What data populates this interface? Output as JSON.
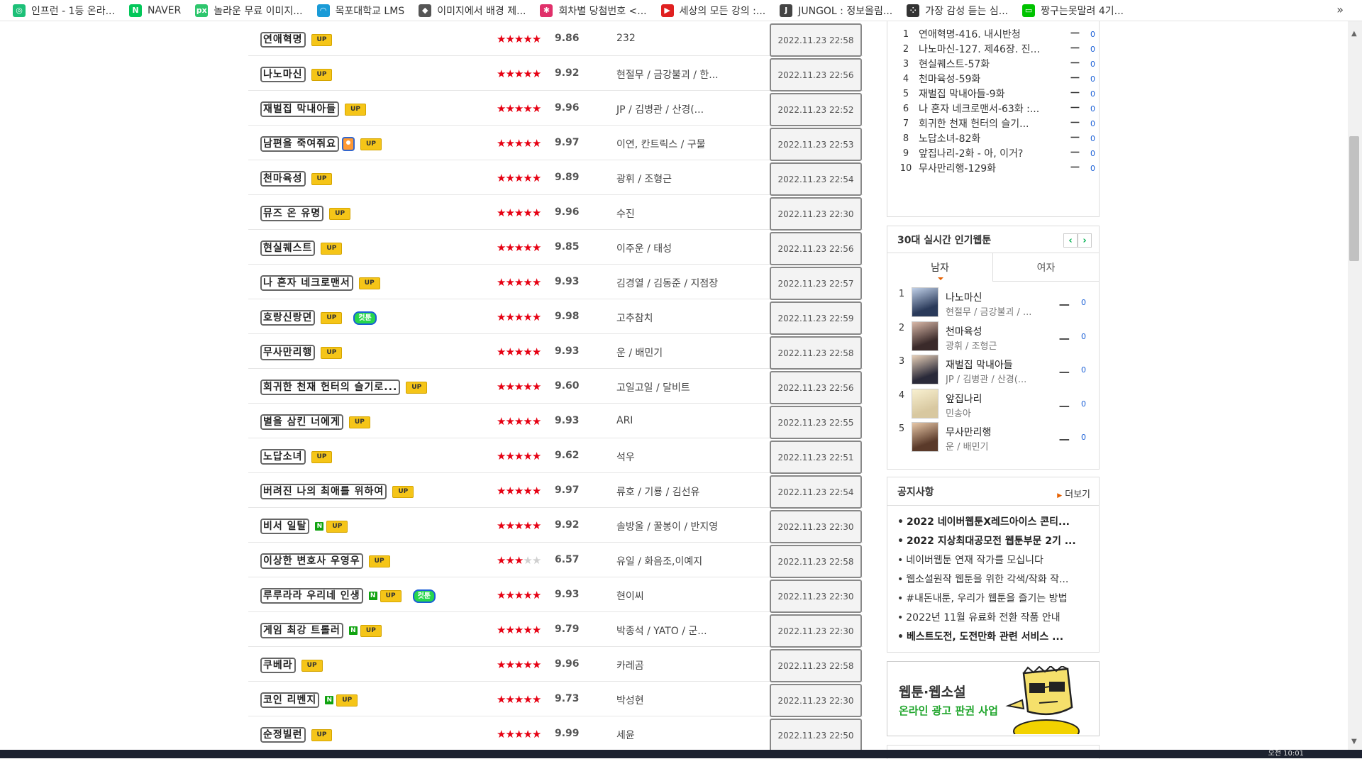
{
  "bookmarks": [
    {
      "label": "인프런 - 1등 온라...",
      "icon": "inflearn-icon",
      "color": "#1dc078",
      "glyph": "◎"
    },
    {
      "label": "NAVER",
      "icon": "naver-icon",
      "color": "#03c75a",
      "glyph": "N"
    },
    {
      "label": "놀라운 무료 이미지...",
      "icon": "pixabay-icon",
      "color": "#2ec66d",
      "glyph": "px"
    },
    {
      "label": "목포대학교 LMS",
      "icon": "lms-icon",
      "color": "#1a9bd7",
      "glyph": "◠"
    },
    {
      "label": "이미지에서 배경 제...",
      "icon": "removebg-icon",
      "color": "#555555",
      "glyph": "◆"
    },
    {
      "label": "회차별 당첨번호 <...",
      "icon": "lotto-icon",
      "color": "#e0306a",
      "glyph": "✱"
    },
    {
      "label": "세상의 모든 강의 :...",
      "icon": "play-icon",
      "color": "#e02020",
      "glyph": "▶"
    },
    {
      "label": "JUNGOL : 정보올림...",
      "icon": "jungol-icon",
      "color": "#444444",
      "glyph": "J"
    },
    {
      "label": "가장 감성 듣는 심...",
      "icon": "music-icon",
      "color": "#333333",
      "glyph": "⁘"
    },
    {
      "label": "짱구는못말려 4기...",
      "icon": "line-icon",
      "color": "#00c300",
      "glyph": "▭"
    }
  ],
  "bookmarks_more": "»",
  "webtoons": [
    {
      "title": "연애혁명",
      "n": false,
      "up": true,
      "extra": "",
      "stars": 5,
      "score": "9.86",
      "author": "232",
      "date": "2022.11.23 22:58"
    },
    {
      "title": "나노마신",
      "n": false,
      "up": true,
      "extra": "",
      "stars": 5,
      "score": "9.92",
      "author": "현절무 / 금강불괴 / 한...",
      "date": "2022.11.23 22:56"
    },
    {
      "title": "재벌집 막내아들",
      "n": false,
      "up": true,
      "extra": "",
      "stars": 5,
      "score": "9.96",
      "author": "JP / 김병관 / 산경(...",
      "date": "2022.11.23 22:52"
    },
    {
      "title": "남편을 죽여줘요",
      "n": false,
      "up": true,
      "extra": "person",
      "stars": 5,
      "score": "9.97",
      "author": "이연, 칸트릭스 / 구물",
      "date": "2022.11.23 22:53"
    },
    {
      "title": "천마육성",
      "n": false,
      "up": true,
      "extra": "",
      "stars": 5,
      "score": "9.89",
      "author": "광휘 / 조형근",
      "date": "2022.11.23 22:54"
    },
    {
      "title": "뮤즈 온 유명",
      "n": false,
      "up": true,
      "extra": "",
      "stars": 5,
      "score": "9.96",
      "author": "수진",
      "date": "2022.11.23 22:30"
    },
    {
      "title": "현실퀘스트",
      "n": false,
      "up": true,
      "extra": "",
      "stars": 5,
      "score": "9.85",
      "author": "이주운 / 태성",
      "date": "2022.11.23 22:56"
    },
    {
      "title": "나 혼자 네크로맨서",
      "n": false,
      "up": true,
      "extra": "",
      "stars": 5,
      "score": "9.93",
      "author": "김경열 / 김동준 / 지점장",
      "date": "2022.11.23 22:57"
    },
    {
      "title": "호랑신랑뎐",
      "n": false,
      "up": true,
      "extra": "cuttoon",
      "stars": 5,
      "score": "9.98",
      "author": "고추참치",
      "date": "2022.11.23 22:59"
    },
    {
      "title": "무사만리행",
      "n": false,
      "up": true,
      "extra": "",
      "stars": 5,
      "score": "9.93",
      "author": "운 / 배민기",
      "date": "2022.11.23 22:58"
    },
    {
      "title": "회귀한 천재 헌터의 슬기로...",
      "n": false,
      "up": true,
      "extra": "",
      "stars": 5,
      "score": "9.60",
      "author": "고일고일 / 달비트",
      "date": "2022.11.23 22:56"
    },
    {
      "title": "별을 삼킨 너에게",
      "n": false,
      "up": true,
      "extra": "",
      "stars": 5,
      "score": "9.93",
      "author": "ARI",
      "date": "2022.11.23 22:55"
    },
    {
      "title": "노답소녀",
      "n": false,
      "up": true,
      "extra": "",
      "stars": 5,
      "score": "9.62",
      "author": "석우",
      "date": "2022.11.23 22:51"
    },
    {
      "title": "버려진 나의 최애를 위하여",
      "n": false,
      "up": true,
      "extra": "",
      "stars": 5,
      "score": "9.97",
      "author": "류호 / 기룡 / 김선유",
      "date": "2022.11.23 22:54"
    },
    {
      "title": "비서 일탈",
      "n": true,
      "up": true,
      "extra": "",
      "stars": 5,
      "score": "9.92",
      "author": "솔방울 / 꿀봉이 / 반지영",
      "date": "2022.11.23 22:30"
    },
    {
      "title": "이상한 변호사 우영우",
      "n": false,
      "up": true,
      "extra": "",
      "stars": 3,
      "score": "6.57",
      "author": "유일 / 화음조,이예지",
      "date": "2022.11.23 22:58"
    },
    {
      "title": "루루라라 우리네 인생",
      "n": true,
      "up": true,
      "extra": "cuttoon",
      "stars": 5,
      "score": "9.93",
      "author": "현이씨",
      "date": "2022.11.23 22:30"
    },
    {
      "title": "게임 최강 트롤러",
      "n": true,
      "up": true,
      "extra": "",
      "stars": 5,
      "score": "9.79",
      "author": "박종석 / YATO / 군...",
      "date": "2022.11.23 22:30"
    },
    {
      "title": "쿠베라",
      "n": false,
      "up": true,
      "extra": "",
      "stars": 5,
      "score": "9.96",
      "author": "카레곰",
      "date": "2022.11.23 22:58"
    },
    {
      "title": "코인 리벤지",
      "n": true,
      "up": true,
      "extra": "",
      "stars": 5,
      "score": "9.73",
      "author": "박성현",
      "date": "2022.11.23 22:30"
    },
    {
      "title": "순정빌런",
      "n": false,
      "up": true,
      "extra": "",
      "stars": 5,
      "score": "9.99",
      "author": "세윤",
      "date": "2022.11.23 22:50"
    }
  ],
  "badges": {
    "up": "UP",
    "n": "N",
    "cuttoon": "컷툰"
  },
  "star_glyph": "★",
  "rank_list": [
    {
      "num": "1",
      "name": "연애혁명-416. 내시반청",
      "change": "ㅡ",
      "count": "0"
    },
    {
      "num": "2",
      "name": "나노마신-127. 제46장. 진...",
      "change": "ㅡ",
      "count": "0"
    },
    {
      "num": "3",
      "name": "현실퀘스트-57화",
      "change": "ㅡ",
      "count": "0"
    },
    {
      "num": "4",
      "name": "천마육성-59화",
      "change": "ㅡ",
      "count": "0"
    },
    {
      "num": "5",
      "name": "재벌집 막내아들-9화",
      "change": "ㅡ",
      "count": "0"
    },
    {
      "num": "6",
      "name": "나 혼자 네크로맨서-63화 :...",
      "change": "ㅡ",
      "count": "0"
    },
    {
      "num": "7",
      "name": "회귀한 천재 헌터의 슬기...",
      "change": "ㅡ",
      "count": "0"
    },
    {
      "num": "8",
      "name": "노답소녀-82화",
      "change": "ㅡ",
      "count": "0"
    },
    {
      "num": "9",
      "name": "앞집나리-2화 - 아, 이거?",
      "change": "ㅡ",
      "count": "0"
    },
    {
      "num": "10",
      "name": "무사만리행-129화",
      "change": "ㅡ",
      "count": "0"
    }
  ],
  "popular": {
    "title": "30대 실시간 인기웹툰",
    "prev": "‹",
    "next": "›",
    "tab_male": "남자",
    "tab_female": "여자",
    "items": [
      {
        "num": "1",
        "title": "나노마신",
        "author": "현절무 / 금강불괴 / ...",
        "change": "ㅡ",
        "count": "0"
      },
      {
        "num": "2",
        "title": "천마육성",
        "author": "광휘 / 조형근",
        "change": "ㅡ",
        "count": "0"
      },
      {
        "num": "3",
        "title": "재벌집 막내아들",
        "author": "JP / 김병관 / 산경(...",
        "change": "ㅡ",
        "count": "0"
      },
      {
        "num": "4",
        "title": "앞집나리",
        "author": "민송아",
        "change": "ㅡ",
        "count": "0"
      },
      {
        "num": "5",
        "title": "무사만리행",
        "author": "운 / 배민기",
        "change": "ㅡ",
        "count": "0"
      }
    ]
  },
  "notice": {
    "title": "공지사항",
    "more": "더보기",
    "items": [
      {
        "text": "2022 네이버웹툰X레드아이스 콘티...",
        "bold": true
      },
      {
        "text": "2022 지상최대공모전 웹툰부문 2기 ...",
        "bold": true
      },
      {
        "text": "네이버웹툰 연재 작가를 모십니다",
        "bold": false
      },
      {
        "text": "웹소설원작 웹툰을 위한 각색/작화 작...",
        "bold": false
      },
      {
        "text": "#내돈내툰, 우리가 웹툰을 즐기는 방법",
        "bold": false
      },
      {
        "text": "2022년 11월 유료화 전환 작품 안내",
        "bold": false
      },
      {
        "text": "베스트도전, 도전만화 관련 서비스 ...",
        "bold": true
      }
    ]
  },
  "ad": {
    "line1": "웹툰·웹소설",
    "line2": "온라인 광고 판권 사업"
  },
  "taskbar": {
    "clock": "오전 10:01"
  },
  "colors": {
    "star_on": "#e60012",
    "up_badge": "#f5c518",
    "n_badge": "#10a310",
    "accent_green": "#00b050",
    "count_blue": "#1a5fd6"
  }
}
